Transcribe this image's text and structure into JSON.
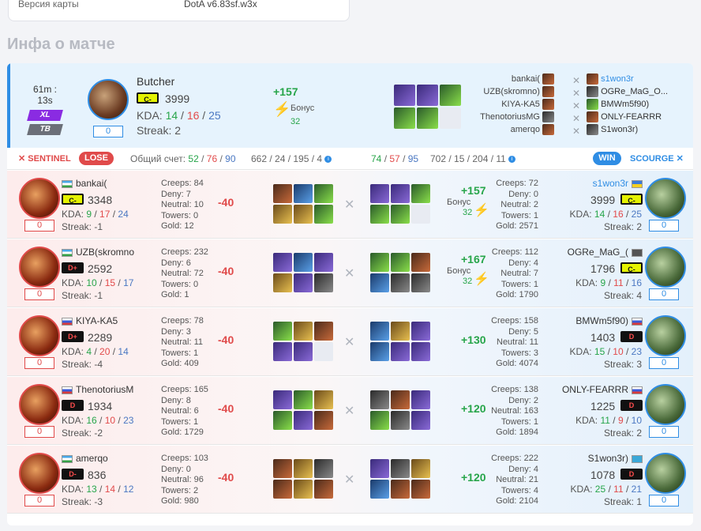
{
  "map": {
    "label": "Версия карты",
    "value": "DotA v6.83sf.w3x"
  },
  "section_title": "Инфа о матче",
  "summary": {
    "time": "61m : 13s",
    "mode": "XL",
    "tag": "TB",
    "hero_name": "Butcher",
    "rank": "C-",
    "rating": "3999",
    "kda_label": "KDA:",
    "kda": [
      "14",
      "16",
      "25"
    ],
    "counter": "0",
    "streak": "Streak: 2",
    "gain": "+157",
    "bonus_label": "Бонус",
    "bonus_value": "32",
    "items": [
      "i0",
      "i0",
      "i1",
      "i1",
      "i1",
      "ie"
    ],
    "teams": [
      {
        "left": "bankai(",
        "right": "s1won3r"
      },
      {
        "left": "UZB(skromno)",
        "right": "OGRe_MaG_O..."
      },
      {
        "left": "KIYA-KA5",
        "right": "BMWm5f90)"
      },
      {
        "left": "ThenotoriusMG",
        "right": "ONLY-FEARRR"
      },
      {
        "left": "amerqo",
        "right": "S1won3r)"
      }
    ]
  },
  "score": {
    "sentinel": "SENTINEL",
    "lose": "LOSE",
    "total_label": "Общий счет:",
    "left_kda": [
      "52",
      "76",
      "90"
    ],
    "left_cs": "662 / 24 / 195 / 4",
    "right_kda": [
      "74",
      "57",
      "95"
    ],
    "right_cs": "702 / 15 / 204 / 11",
    "win": "WIN",
    "scourge": "SCOURGE"
  },
  "rows": [
    {
      "left": {
        "name": "bankai(",
        "flag": "uz",
        "rank": "C-",
        "rating": "3348",
        "kda": [
          "9",
          "17",
          "24"
        ],
        "streak": "Streak: -1",
        "counter": "0",
        "stats": [
          "Creeps: 84",
          "Deny: 7",
          "Neutral: 10",
          "Towers: 0",
          "Gold: 12"
        ],
        "delta": "-40",
        "items": [
          "i4",
          "i3",
          "i1",
          "i2",
          "i2",
          "i1"
        ]
      },
      "right": {
        "name": "s1won3r",
        "flag": "ua",
        "rank": "C-",
        "rating": "3999",
        "kda": [
          "14",
          "16",
          "25"
        ],
        "streak": "Streak: 2",
        "counter": "0",
        "stats": [
          "Creeps: 72",
          "Deny: 0",
          "Neutral: 2",
          "Towers: 1",
          "Gold: 2571"
        ],
        "delta": "+157",
        "bonus": "Бонус",
        "bonus_value": "32",
        "items": [
          "i0",
          "i0",
          "i1",
          "i1",
          "i1",
          "ie"
        ]
      }
    },
    {
      "left": {
        "name": "UZB(skromno",
        "flag": "uz",
        "rank": "D+",
        "rating": "2592",
        "kda": [
          "10",
          "15",
          "17"
        ],
        "streak": "Streak: -1",
        "counter": "0",
        "stats": [
          "Creeps: 232",
          "Deny: 6",
          "Neutral: 72",
          "Towers: 0",
          "Gold: 1"
        ],
        "delta": "-40",
        "items": [
          "i0",
          "i3",
          "i0",
          "i2",
          "i0",
          "i5"
        ]
      },
      "right": {
        "name": "OGRe_MaG_(",
        "flag": "un",
        "rank": "C-",
        "rating": "1796",
        "kda": [
          "9",
          "11",
          "16"
        ],
        "streak": "Streak: 4",
        "counter": "0",
        "stats": [
          "Creeps: 112",
          "Deny: 4",
          "Neutral: 7",
          "Towers: 1",
          "Gold: 1790"
        ],
        "delta": "+167",
        "bonus": "Бонус",
        "bonus_value": "32",
        "items": [
          "i1",
          "i1",
          "i4",
          "i3",
          "i5",
          "i5"
        ]
      }
    },
    {
      "left": {
        "name": "KIYA-KA5",
        "flag": "ru",
        "rank": "D+",
        "rating": "2289",
        "kda": [
          "4",
          "20",
          "14"
        ],
        "streak": "Streak: -4",
        "counter": "0",
        "stats": [
          "Creeps: 78",
          "Deny: 3",
          "Neutral: 11",
          "Towers: 1",
          "Gold: 409"
        ],
        "delta": "-40",
        "items": [
          "i1",
          "i2",
          "i4",
          "i0",
          "i0",
          "ie"
        ]
      },
      "right": {
        "name": "BMWm5f90)",
        "flag": "ru",
        "rank": "D",
        "rating": "1403",
        "kda": [
          "15",
          "10",
          "23"
        ],
        "streak": "Streak: 3",
        "counter": "0",
        "stats": [
          "Creeps: 158",
          "Deny: 5",
          "Neutral: 11",
          "Towers: 3",
          "Gold: 4074"
        ],
        "delta": "+130",
        "items": [
          "i3",
          "i2",
          "i0",
          "i3",
          "i0",
          "i0"
        ]
      }
    },
    {
      "left": {
        "name": "ThenotoriusM",
        "flag": "ru",
        "rank": "D",
        "rating": "1934",
        "kda": [
          "16",
          "10",
          "23"
        ],
        "streak": "Streak: -2",
        "counter": "0",
        "stats": [
          "Creeps: 165",
          "Deny: 8",
          "Neutral: 6",
          "Towers: 1",
          "Gold: 1729"
        ],
        "delta": "-40",
        "items": [
          "i0",
          "i1",
          "i2",
          "i1",
          "i0",
          "i4"
        ]
      },
      "right": {
        "name": "ONLY-FEARRR",
        "flag": "ru",
        "rank": "D",
        "rating": "1225",
        "kda": [
          "11",
          "9",
          "10"
        ],
        "streak": "Streak: 2",
        "counter": "0",
        "stats": [
          "Creeps: 138",
          "Deny: 2",
          "Neutral: 163",
          "Towers: 1",
          "Gold: 1894"
        ],
        "delta": "+120",
        "items": [
          "i5",
          "i4",
          "i0",
          "i1",
          "i5",
          "i0"
        ]
      }
    },
    {
      "left": {
        "name": "amerqo",
        "flag": "uz",
        "rank": "D-",
        "rating": "836",
        "kda": [
          "13",
          "14",
          "12"
        ],
        "streak": "Streak: -3",
        "counter": "0",
        "stats": [
          "Creeps: 103",
          "Deny: 0",
          "Neutral: 96",
          "Towers: 2",
          "Gold: 980"
        ],
        "delta": "-40",
        "items": [
          "i4",
          "i2",
          "i5",
          "i4",
          "i2",
          "i4"
        ]
      },
      "right": {
        "name": "S1won3r)",
        "flag": "kz",
        "rank": "D",
        "rating": "1078",
        "kda": [
          "25",
          "11",
          "21"
        ],
        "streak": "Streak: 1",
        "counter": "0",
        "stats": [
          "Creeps: 222",
          "Deny: 4",
          "Neutral: 21",
          "Towers: 4",
          "Gold: 2104"
        ],
        "delta": "+120",
        "items": [
          "i0",
          "i5",
          "i2",
          "i3",
          "i4",
          "i4"
        ]
      }
    }
  ]
}
